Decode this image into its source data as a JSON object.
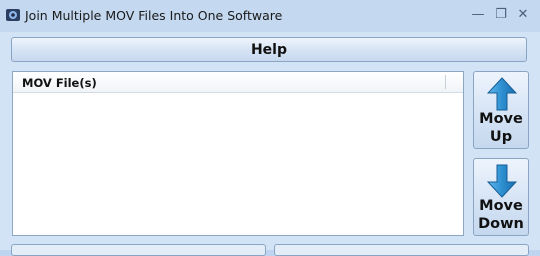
{
  "window": {
    "title": "Join Multiple MOV Files Into One Software",
    "controls": {
      "minimize": "—",
      "maximize": "❐",
      "close": "✕"
    }
  },
  "toolbar": {
    "help_label": "Help"
  },
  "file_list": {
    "column_header": "MOV File(s)",
    "items": []
  },
  "side_buttons": {
    "move_up": {
      "line1": "Move",
      "line2": "Up"
    },
    "move_down": {
      "line1": "Move",
      "line2": "Down"
    }
  },
  "colors": {
    "arrow": "#2d8fd0",
    "window_bg": "#d3e3f6"
  },
  "icons": [
    "app-icon",
    "up-arrow-icon",
    "down-arrow-icon"
  ]
}
